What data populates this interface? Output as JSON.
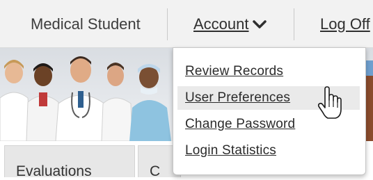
{
  "header": {
    "role_label": "Medical Student",
    "account_label": "Account",
    "logoff_label": "Log Off"
  },
  "account_menu": {
    "items": [
      {
        "label": "Review Records"
      },
      {
        "label": "User Preferences",
        "highlighted": true
      },
      {
        "label": "Change Password"
      },
      {
        "label": "Login Statistics"
      }
    ]
  },
  "tabs": [
    {
      "label": "Evaluations"
    },
    {
      "label": "C"
    }
  ],
  "colors": {
    "topbar_bg": "#f2f2f2",
    "menu_highlight": "#eaeaea",
    "banner_blue": "#6f9fcf"
  },
  "icons": {
    "account_caret": "chevron-down-icon",
    "pointer": "hand-pointer-icon"
  }
}
